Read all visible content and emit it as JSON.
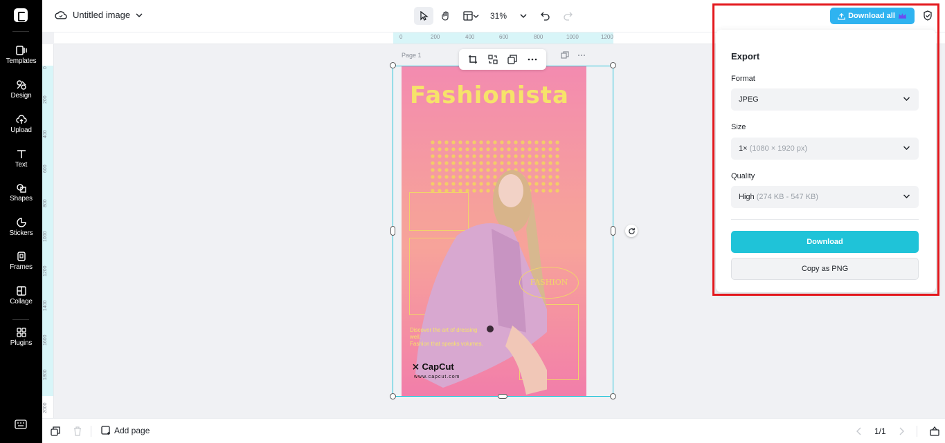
{
  "sidebar": {
    "items": [
      {
        "label": "Templates",
        "icon": "templates-icon"
      },
      {
        "label": "Design",
        "icon": "design-icon"
      },
      {
        "label": "Upload",
        "icon": "upload-icon"
      },
      {
        "label": "Text",
        "icon": "text-icon"
      },
      {
        "label": "Shapes",
        "icon": "shapes-icon"
      },
      {
        "label": "Stickers",
        "icon": "stickers-icon"
      },
      {
        "label": "Frames",
        "icon": "frames-icon"
      },
      {
        "label": "Collage",
        "icon": "collage-icon"
      },
      {
        "label": "Plugins",
        "icon": "plugins-icon"
      }
    ]
  },
  "header": {
    "title": "Untitled image",
    "zoom": "31%",
    "download_all_label": "Download all"
  },
  "ruler": {
    "top": [
      "0",
      "200",
      "400",
      "600",
      "800",
      "1000",
      "1200"
    ],
    "left": [
      "0",
      "200",
      "400",
      "600",
      "800",
      "1000",
      "1200",
      "1400",
      "1600",
      "1800",
      "2000"
    ]
  },
  "canvas": {
    "page_label": "Page 1",
    "poster": {
      "title": "Fashionista",
      "oval_text": "FASHION",
      "tagline_lines": [
        "Discover the art of dressing",
        "well.",
        "Fashion that speaks volumes."
      ],
      "brand": "CapCut",
      "url": "www.capcut.com"
    }
  },
  "export": {
    "heading": "Export",
    "format_label": "Format",
    "format_value": "JPEG",
    "size_label": "Size",
    "size_value": "1×",
    "size_detail": "(1080 × 1920 px)",
    "quality_label": "Quality",
    "quality_value": "High",
    "quality_detail": "(274 KB - 547 KB)",
    "download_label": "Download",
    "copy_label": "Copy as PNG"
  },
  "bottom": {
    "add_page_label": "Add page",
    "pager": "1/1"
  },
  "colors": {
    "accent": "#1fc3d8",
    "download_all": "#2fb3f0",
    "highlight": "#e3161b"
  }
}
